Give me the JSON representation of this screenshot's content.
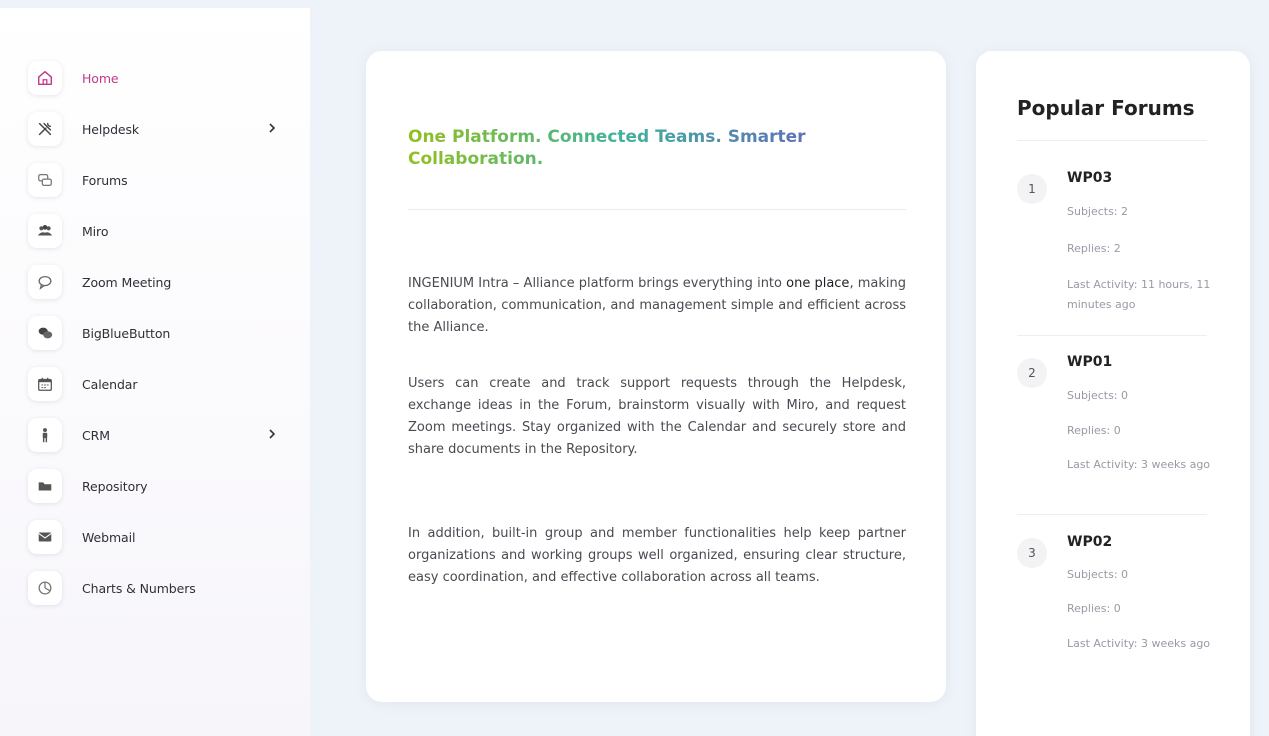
{
  "sidebar": {
    "items": [
      {
        "label": "Home",
        "icon": "home-icon"
      },
      {
        "label": "Helpdesk",
        "icon": "tools-icon"
      },
      {
        "label": "Forums",
        "icon": "forums-icon"
      },
      {
        "label": "Miro",
        "icon": "group-icon"
      },
      {
        "label": "Zoom Meeting",
        "icon": "chat-icon"
      },
      {
        "label": "BigBlueButton",
        "icon": "bbb-icon"
      },
      {
        "label": "Calendar",
        "icon": "calendar-icon"
      },
      {
        "label": "CRM",
        "icon": "person-icon"
      },
      {
        "label": "Repository",
        "icon": "folder-icon"
      },
      {
        "label": "Webmail",
        "icon": "mail-icon"
      },
      {
        "label": "Charts & Numbers",
        "icon": "chart-icon"
      }
    ],
    "active_color": "#c23b85"
  },
  "main": {
    "headline": "One Platform. Connected Teams. Smarter Collaboration.",
    "p1_a": "INGENIUM Intra – Alliance platform brings everything into ",
    "p1_b": "one place",
    "p1_c": ", making collaboration, communication, and management simple and efficient across the Alliance.",
    "p2": "Users can create and track support requests through the Helpdesk, exchange ideas in the Forum, brainstorm visually with Miro, and request Zoom meetings. Stay organized with the Calendar and securely store and share documents in the Repository.",
    "p3": "In addition, built-in group and member functionalities help keep partner organizations and working groups well organized, ensuring clear structure, easy coordination, and effective collaboration across all teams."
  },
  "popular": {
    "title": "Popular Forums",
    "forums": [
      {
        "rank": "1",
        "name": "WP03",
        "subjects": "Subjects: 2",
        "replies": "Replies: 2",
        "activity": "Last Activity: 11 hours, 11 minutes ago"
      },
      {
        "rank": "2",
        "name": "WP01",
        "subjects": "Subjects: 0",
        "replies": "Replies: 0",
        "activity": "Last Activity: 3 weeks ago"
      },
      {
        "rank": "3",
        "name": "WP02",
        "subjects": "Subjects: 0",
        "replies": "Replies: 0",
        "activity": "Last Activity: 3 weeks ago"
      }
    ]
  }
}
